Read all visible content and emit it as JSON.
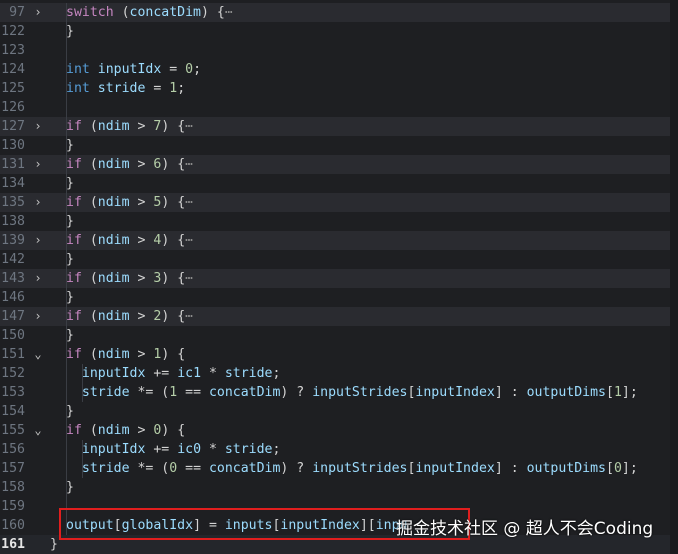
{
  "lines": [
    {
      "num": "97",
      "fold": "›",
      "code": "switch (concatDim) {···",
      "folded": true
    },
    {
      "num": "122",
      "fold": "",
      "code": "}"
    },
    {
      "num": "123",
      "fold": "",
      "code": ""
    },
    {
      "num": "124",
      "fold": "",
      "code": "int inputIdx = 0;"
    },
    {
      "num": "125",
      "fold": "",
      "code": "int stride = 1;"
    },
    {
      "num": "126",
      "fold": "",
      "code": ""
    },
    {
      "num": "127",
      "fold": "›",
      "code": "if (ndim > 7) {···",
      "folded": true
    },
    {
      "num": "130",
      "fold": "",
      "code": "}"
    },
    {
      "num": "131",
      "fold": "›",
      "code": "if (ndim > 6) {···",
      "folded": true
    },
    {
      "num": "134",
      "fold": "",
      "code": "}"
    },
    {
      "num": "135",
      "fold": "›",
      "code": "if (ndim > 5) {···",
      "folded": true
    },
    {
      "num": "138",
      "fold": "",
      "code": "}"
    },
    {
      "num": "139",
      "fold": "›",
      "code": "if (ndim > 4) {···",
      "folded": true
    },
    {
      "num": "142",
      "fold": "",
      "code": "}"
    },
    {
      "num": "143",
      "fold": "›",
      "code": "if (ndim > 3) {···",
      "folded": true
    },
    {
      "num": "146",
      "fold": "",
      "code": "}"
    },
    {
      "num": "147",
      "fold": "›",
      "code": "if (ndim > 2) {···",
      "folded": true
    },
    {
      "num": "150",
      "fold": "",
      "code": "}"
    },
    {
      "num": "151",
      "fold": "⌄",
      "code": "if (ndim > 1) {"
    },
    {
      "num": "152",
      "fold": "",
      "code": "  inputIdx += ic1 * stride;"
    },
    {
      "num": "153",
      "fold": "",
      "code": "  stride *= (1 == concatDim) ? inputStrides[inputIndex] : outputDims[1];"
    },
    {
      "num": "154",
      "fold": "",
      "code": "}"
    },
    {
      "num": "155",
      "fold": "⌄",
      "code": "if (ndim > 0) {"
    },
    {
      "num": "156",
      "fold": "",
      "code": "  inputIdx += ic0 * stride;"
    },
    {
      "num": "157",
      "fold": "",
      "code": "  stride *= (0 == concatDim) ? inputStrides[inputIndex] : outputDims[0];"
    },
    {
      "num": "158",
      "fold": "",
      "code": "}"
    },
    {
      "num": "159",
      "fold": "",
      "code": ""
    },
    {
      "num": "160",
      "fold": "",
      "code": "output[globalIdx] = inputs[inputIndex][inpu"
    },
    {
      "num": "161",
      "fold": "",
      "code": "}",
      "current": true
    }
  ],
  "watermark": "掘金技术社区 @ 超人不会Coding",
  "colors": {
    "background": "#1e1f22",
    "keyword": "#c586c0",
    "annotation_box": "#e01e1e"
  }
}
